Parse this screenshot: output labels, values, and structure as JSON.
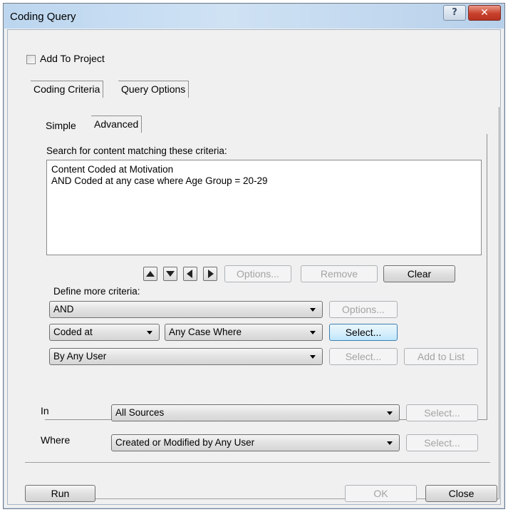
{
  "window": {
    "title": "Coding Query",
    "help_glyph": "?",
    "close_glyph": "✕"
  },
  "add_to_project": {
    "label": "Add To Project",
    "checked": false
  },
  "tabs": [
    {
      "label": "Coding Criteria",
      "active": true
    },
    {
      "label": "Query Options",
      "active": false
    }
  ],
  "subtabs": [
    {
      "label": "Simple",
      "active": false
    },
    {
      "label": "Advanced",
      "active": true
    }
  ],
  "criteria": {
    "heading": "Search for content matching these criteria:",
    "lines": [
      "Content Coded at Motivation",
      "AND Coded at any case where Age Group = 20-29"
    ]
  },
  "list_buttons": {
    "icons": [
      "arrow-up-icon",
      "arrow-down-icon",
      "arrow-left-icon",
      "arrow-right-icon"
    ],
    "options": "Options...",
    "remove": "Remove",
    "clear": "Clear"
  },
  "define": {
    "label": "Define more criteria:",
    "operator": "AND",
    "operator_options_btn": "Options...",
    "coded": "Coded at",
    "case": "Any Case Where",
    "select_btn": "Select...",
    "user": "By Any User",
    "user_select_btn": "Select...",
    "add_to_list": "Add to List"
  },
  "scope": {
    "in_label": "In",
    "in_value": "All Sources",
    "in_select": "Select...",
    "where_label": "Where",
    "where_value": "Created or Modified by Any User",
    "where_select": "Select..."
  },
  "footer": {
    "run": "Run",
    "ok": "OK",
    "close": "Close"
  },
  "colors": {
    "title_gradient": "#bcd6ef",
    "close_button": "#c9412c",
    "focus_border": "#3c7fb1"
  }
}
